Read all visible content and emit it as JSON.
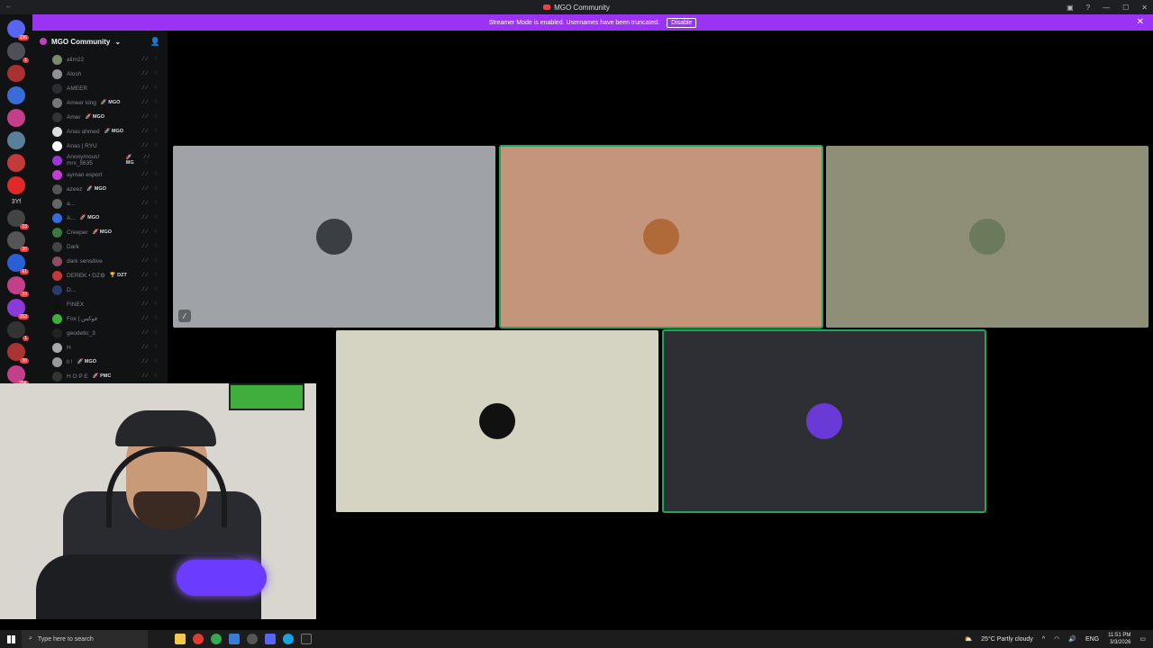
{
  "window": {
    "title": "MGO Community"
  },
  "banner": {
    "text": "Streamer Mode is enabled. Usernames have been truncated.",
    "button": "Disable"
  },
  "rail": {
    "servers": [
      {
        "badge": "336",
        "color": "#5865f2"
      },
      {
        "badge": "1",
        "color": "#4e5058"
      },
      {
        "badge": "",
        "color": "#a83232"
      },
      {
        "badge": "",
        "color": "#3a6bd6"
      },
      {
        "badge": "",
        "color": "#c43f8a"
      },
      {
        "badge": "",
        "color": "#5a7f9a"
      },
      {
        "badge": "",
        "color": "#c43a3a"
      },
      {
        "badge": "",
        "color": "#e02a2a"
      }
    ],
    "text_item": "3Yf",
    "servers2": [
      {
        "badge": "23",
        "color": "#444"
      },
      {
        "badge": "20",
        "color": "#555"
      },
      {
        "badge": "61",
        "color": "#2a5fd6"
      },
      {
        "badge": "23",
        "color": "#c43f8a"
      },
      {
        "badge": "153",
        "color": "#8a3ad6"
      },
      {
        "badge": "1",
        "color": "#333"
      },
      {
        "badge": "30",
        "color": "#a33"
      },
      {
        "badge": "25K",
        "color": "#c43f8a"
      }
    ]
  },
  "sidebar": {
    "server_name": "MGO Community",
    "members": [
      {
        "name": "alim22",
        "tag": "",
        "color": "#7a8a6a"
      },
      {
        "name": "Alosh",
        "tag": "",
        "color": "#8e9297"
      },
      {
        "name": "AMEER",
        "tag": "",
        "color": "#2b2d31"
      },
      {
        "name": "Ameer king",
        "tag": "🚀 MGO",
        "color": "#777"
      },
      {
        "name": "Amer",
        "tag": "🚀 MGO",
        "color": "#333"
      },
      {
        "name": "Anas ahmed",
        "tag": "🚀 MGO",
        "color": "#ddd"
      },
      {
        "name": "Anas | RYU",
        "tag": "",
        "color": "#fff"
      },
      {
        "name": "Anonymous! mrx_5635",
        "tag": "🚀 MG",
        "color": "#9a3ad6"
      },
      {
        "name": "ayman esport",
        "tag": "",
        "color": "#c43fcf"
      },
      {
        "name": "azeez",
        "tag": "🚀 MGO",
        "color": "#555"
      },
      {
        "name": "a...",
        "tag": "",
        "color": "#666"
      },
      {
        "name": "A...",
        "tag": "🚀 MGO",
        "color": "#3a6bd6"
      },
      {
        "name": "Creeper",
        "tag": "🚀 MGO",
        "color": "#3a7a3a"
      },
      {
        "name": "Dark",
        "tag": "",
        "color": "#444"
      },
      {
        "name": "dark sensitive",
        "tag": "",
        "color": "#8a5060"
      },
      {
        "name": "DEREK • DZ⚙",
        "tag": "🏆 DZT",
        "color": "#c43a3a"
      },
      {
        "name": "D...",
        "tag": "",
        "color": "#2a3a6a"
      },
      {
        "name": "FINEX",
        "tag": "",
        "color": "#111"
      },
      {
        "name": "Fox | فوكس",
        "tag": "",
        "color": "#3fae3c"
      },
      {
        "name": "geodetic_3",
        "tag": "",
        "color": "#222"
      },
      {
        "name": "H",
        "tag": "",
        "color": "#aaa"
      },
      {
        "name": "ll !",
        "tag": "🚀 MGO",
        "color": "#999"
      },
      {
        "name": "H O P E",
        "tag": "🚀 PMC",
        "color": "#333"
      }
    ]
  },
  "tiles": [
    {
      "name": "tile-1",
      "bg": "#9fa3a8",
      "avatar": "#3a3f44"
    },
    {
      "name": "tile-2",
      "bg": "#c4957a",
      "avatar": "#b06a3a"
    },
    {
      "name": "tile-3",
      "bg": "#8f8f77",
      "avatar": "#6a7a5a"
    },
    {
      "name": "tile-4",
      "bg": "#d5d3c2",
      "avatar": "#111"
    },
    {
      "name": "tile-5",
      "bg": "#2e2f35",
      "avatar": "#6a3ad6"
    }
  ],
  "taskbar": {
    "search_placeholder": "Type here to search",
    "weather": "25°C  Partly cloudy",
    "lang": "ENG",
    "time": "11:51 PM",
    "date": "3/3/2026"
  }
}
